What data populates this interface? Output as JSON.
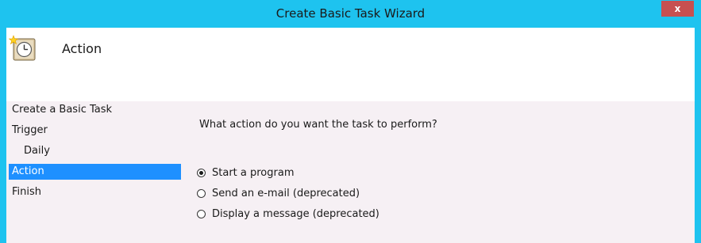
{
  "window": {
    "title": "Create Basic Task Wizard",
    "close_label": "x"
  },
  "header": {
    "title": "Action",
    "icon": "task-scheduler-clock-icon"
  },
  "steps": [
    {
      "label": "Create a Basic Task",
      "indent": false,
      "active": false
    },
    {
      "label": "Trigger",
      "indent": false,
      "active": false
    },
    {
      "label": "Daily",
      "indent": true,
      "active": false
    },
    {
      "label": "Action",
      "indent": false,
      "active": true
    },
    {
      "label": "Finish",
      "indent": false,
      "active": false
    }
  ],
  "main": {
    "question": "What action do you want the task to perform?",
    "options": [
      {
        "label": "Start a program",
        "checked": true
      },
      {
        "label": "Send an e-mail (deprecated)",
        "checked": false
      },
      {
        "label": "Display a message (deprecated)",
        "checked": false
      }
    ]
  },
  "colors": {
    "titlebar": "#1ec3ef",
    "close_button": "#c75050",
    "active_step": "#1e90ff",
    "content_background": "#f6f0f4"
  }
}
